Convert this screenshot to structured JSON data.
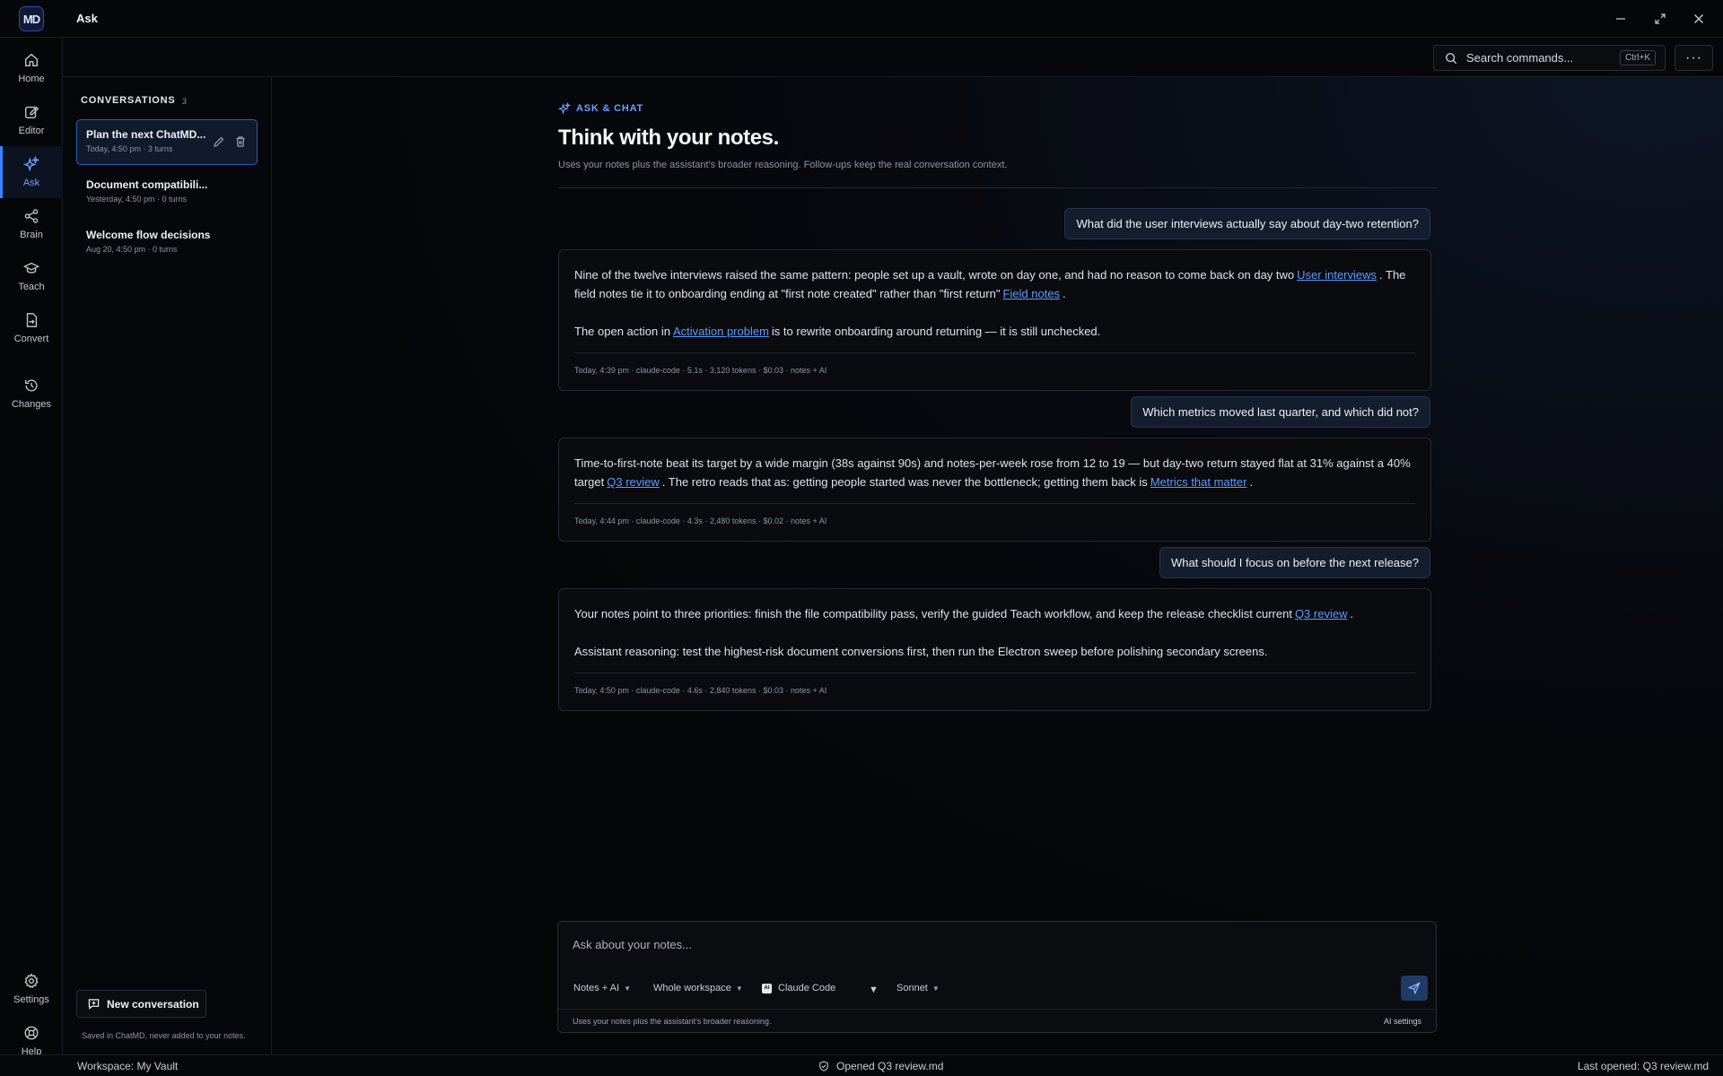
{
  "app": {
    "logo": "MD",
    "title": "Ask"
  },
  "window_controls": [
    "minimize-icon",
    "maximize-icon",
    "close-icon"
  ],
  "rail": {
    "items": [
      {
        "label": "Home",
        "icon": "home-icon"
      },
      {
        "label": "Editor",
        "icon": "edit-icon"
      },
      {
        "label": "Ask",
        "icon": "sparkles-icon",
        "active": true
      },
      {
        "label": "Brain",
        "icon": "share-nodes-icon"
      },
      {
        "label": "Teach",
        "icon": "graduation-cap-icon"
      },
      {
        "label": "Convert",
        "icon": "file-convert-icon"
      },
      {
        "label": "Changes",
        "icon": "history-icon"
      }
    ],
    "bottom": [
      {
        "label": "Settings",
        "icon": "gear-icon"
      },
      {
        "label": "Help",
        "icon": "help-circle-icon"
      }
    ]
  },
  "toolbar": {
    "search_placeholder": "Search commands...",
    "search_shortcut": "Ctrl+K",
    "more_label": "···"
  },
  "conversations": {
    "heading": "CONVERSATIONS",
    "count": "3",
    "items": [
      {
        "title": "Plan the next ChatMD...",
        "meta": "Today, 4:50 pm · 3 turns",
        "active": true
      },
      {
        "title": "Document compatibili...",
        "meta": "Yesterday, 4:50 pm · 0 turns"
      },
      {
        "title": "Welcome flow decisions",
        "meta": "Aug 20, 4:50 pm · 0 turns"
      }
    ],
    "new_button": "New conversation",
    "saved_note": "Saved in ChatMD, never added to your notes."
  },
  "main": {
    "eyebrow": "ASK & CHAT",
    "title": "Think with your notes.",
    "subtitle": "Uses your notes plus the assistant's broader reasoning. Follow-ups keep the real conversation context.",
    "turns": [
      {
        "question": "What did the user interviews actually say about day-two retention?",
        "answer": {
          "p1_a": "Nine of the twelve interviews raised the same pattern: people set up a vault, wrote on day one, and had no reason to come back on day two",
          "p1_link1": "User interviews",
          "p1_b": ". The field notes tie it to onboarding ending at \"first note created\" rather than \"first return\"",
          "p1_link2": "Field notes",
          "p1_c": ".",
          "p2_a": "The open action in",
          "p2_link": "Activation problem",
          "p2_b": "is to rewrite onboarding around returning — it is still unchecked."
        },
        "meta": "Today, 4:39 pm · claude-code · 5.1s · 3,120 tokens · $0.03 · notes + AI"
      },
      {
        "question": "Which metrics moved last quarter, and which did not?",
        "answer": {
          "p1_a": "Time-to-first-note beat its target by a wide margin (38s against 90s) and notes-per-week rose from 12 to 19 — but day-two return stayed flat at 31% against a 40% target",
          "p1_link1": "Q3 review",
          "p1_b": ". The retro reads that as: getting people started was never the bottleneck; getting them back is",
          "p1_link2": "Metrics that matter",
          "p1_c": "."
        },
        "meta": "Today, 4:44 pm · claude-code · 4.3s · 2,480 tokens · $0.02 · notes + AI"
      },
      {
        "question": "What should I focus on before the next release?",
        "answer": {
          "p1_a": "Your notes point to three priorities: finish the file compatibility pass, verify the guided Teach workflow, and keep the release checklist current",
          "p1_link1": "Q3 review",
          "p1_c": ".",
          "p2_a": "Assistant reasoning: test the highest-risk document conversions first, then run the Electron sweep before polishing secondary screens."
        },
        "meta": "Today, 4:50 pm · claude-code · 4.6s · 2,840 tokens · $0.03 · notes + AI"
      }
    ]
  },
  "composer": {
    "placeholder": "Ask about your notes...",
    "mode": "Notes + AI",
    "scope": "Whole workspace",
    "provider_badge": "AI",
    "provider": "Claude Code",
    "model": "Sonnet",
    "footer": "Uses your notes plus the assistant's broader reasoning.",
    "settings_link": "AI settings"
  },
  "statusbar": {
    "workspace": "Workspace: My Vault",
    "center": "Opened Q3 review.md",
    "right": "Last opened: Q3 review.md"
  },
  "colors": {
    "accent": "#3e82ff",
    "link": "#5e9bff",
    "background": "#050608"
  }
}
